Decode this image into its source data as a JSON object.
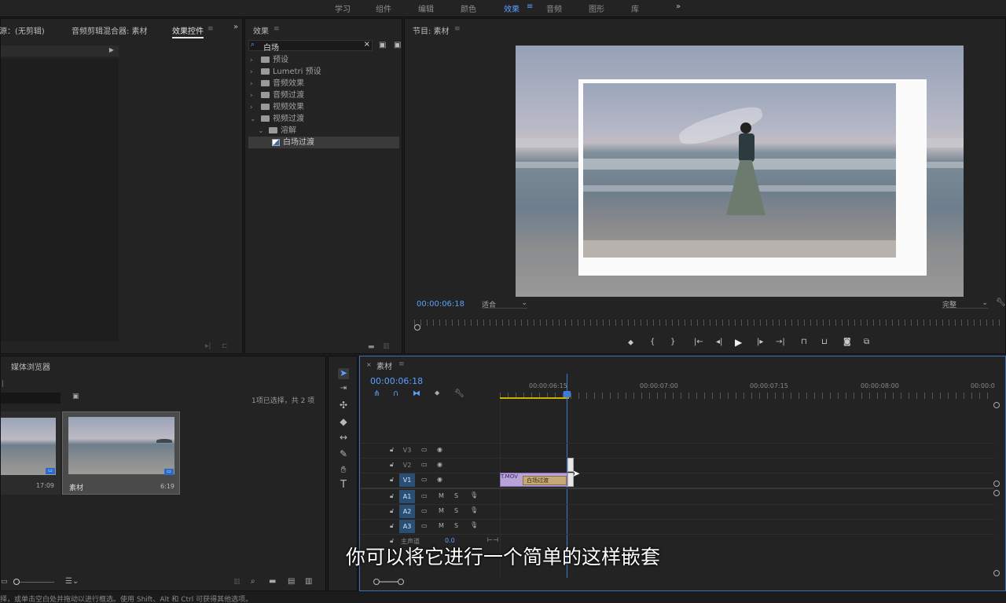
{
  "workspaces": [
    "学习",
    "组件",
    "编辑",
    "颜色",
    "效果",
    "音频",
    "图形",
    "库"
  ],
  "workspace_active": "效果",
  "more_icon": "»",
  "source_panel": {
    "tabs": [
      "源：(无剪辑)",
      "音频剪辑混合器: 素材",
      "效果控件"
    ],
    "active_tab": "效果控件"
  },
  "effects_panel": {
    "title": "效果",
    "search_value": "白场",
    "tree": [
      {
        "label": "预设",
        "level": 0,
        "open": false
      },
      {
        "label": "Lumetri 预设",
        "level": 0,
        "open": false
      },
      {
        "label": "音频效果",
        "level": 0,
        "open": false
      },
      {
        "label": "音频过渡",
        "level": 0,
        "open": false
      },
      {
        "label": "视频效果",
        "level": 0,
        "open": false
      },
      {
        "label": "视频过渡",
        "level": 0,
        "open": true
      },
      {
        "label": "溶解",
        "level": 1,
        "open": true
      },
      {
        "label": "白场过渡",
        "level": 2,
        "selected": true
      }
    ]
  },
  "program_monitor": {
    "title": "节目: 素材",
    "timecode": "00:00:06:18",
    "fit": "适合",
    "quality": "完整",
    "sky_color": "#9aa4b8"
  },
  "media_browser": {
    "title": "媒体浏览器",
    "selection_info": "1项已选择，共 2 项",
    "clips": [
      {
        "name": "",
        "duration": "17:09"
      },
      {
        "name": "素材",
        "duration": "6:19"
      }
    ]
  },
  "timeline": {
    "title": "素材",
    "timecode": "00:00:06:18",
    "ruler": [
      "00:00:06:15",
      "00:00:07:00",
      "00:00:07:15",
      "00:00:08:00",
      "00:00:0"
    ],
    "video_tracks": [
      "V3",
      "V2",
      "V1"
    ],
    "audio_tracks": [
      "A1",
      "A2",
      "A3"
    ],
    "master_label": "主声道",
    "master_value": "0.0",
    "clip_name": "T.MOV",
    "transition_label": "白场过渡",
    "m_label": "M",
    "s_label": "S"
  },
  "subtitle": "你可以将它进行一个简单的这样嵌套",
  "status_bar": "择，或单击空白处并拖动以进行框选。使用 Shift、Alt 和 Ctrl 可获得其他选项。"
}
